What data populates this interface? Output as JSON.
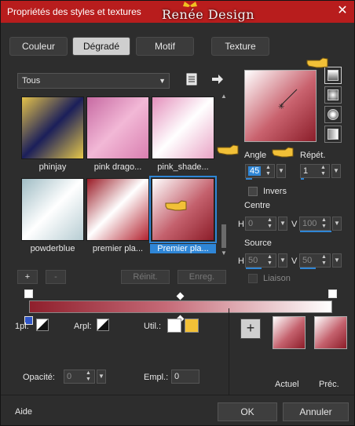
{
  "window": {
    "title": "Propriétés des styles et textures",
    "brand": "Renée Design",
    "close_glyph": "✕"
  },
  "tabs": [
    {
      "label": "Couleur"
    },
    {
      "label": "Dégradé",
      "active": true
    },
    {
      "label": "Motif"
    },
    {
      "label": "Texture"
    }
  ],
  "category": {
    "selected": "Tous"
  },
  "presets": [
    {
      "label": "phinjay",
      "colors": [
        "#d8b53a",
        "#1b1f5a",
        "#e6c84a"
      ]
    },
    {
      "label": "pink drago...",
      "colors": [
        "#d97fb0",
        "#f2b8d6",
        "#c76aa2"
      ]
    },
    {
      "label": "pink_shade...",
      "colors": [
        "#e9a3c5",
        "#ffffff",
        "#e48fbb"
      ]
    },
    {
      "label": "powderblue",
      "colors": [
        "#9fbcc4",
        "#ffffff",
        "#b7cdd3"
      ]
    },
    {
      "label": "premier pla...",
      "colors": [
        "#9a1b26",
        "#ffffff",
        "#b3222f"
      ]
    },
    {
      "label": "Premier pla...",
      "colors": [
        "#ffffff",
        "#c4616d",
        "#8c1d29"
      ],
      "selected": true
    }
  ],
  "preset_buttons": {
    "add": "+",
    "remove": "-",
    "reset": "Réinit.",
    "save": "Enreg."
  },
  "angle": {
    "label": "Angle",
    "value": "45"
  },
  "repeat": {
    "label": "Répét.",
    "value": "1"
  },
  "invert": {
    "label": "Invers",
    "checked": false
  },
  "center": {
    "label": "Centre",
    "h_label": "H",
    "h_value": "0",
    "v_label": "V",
    "v_value": "100"
  },
  "source": {
    "label": "Source",
    "h_label": "H",
    "h_value": "50",
    "v_label": "V",
    "v_value": "50"
  },
  "link": {
    "label": "Liaison"
  },
  "stops": {
    "left_color": "#8f1f2c",
    "right_color": "#ffffff"
  },
  "opacity_row": {
    "pos_label": "1pl:",
    "arpl_label": "Arpl:",
    "util_label": "Util.:",
    "util_colors": [
      "#ffffff",
      "#f2c037"
    ]
  },
  "opacity": {
    "label": "Opacité:",
    "value": "0",
    "empl_label": "Empl.:",
    "empl_value": "0"
  },
  "swatches": {
    "add": "+",
    "current_label": "Actuel",
    "previous_label": "Préc."
  },
  "footer": {
    "help": "Aide",
    "ok": "OK",
    "cancel": "Annuler"
  },
  "colors": {
    "title_bar": "#b81d1d",
    "accent": "#2f86d6"
  }
}
